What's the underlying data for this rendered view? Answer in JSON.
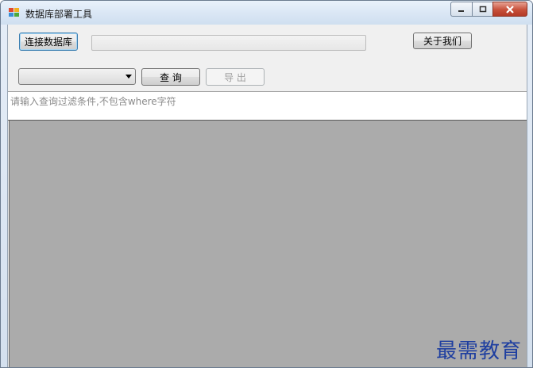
{
  "window": {
    "title": "数据库部署工具",
    "minimize_label": "minimize",
    "maximize_label": "maximize",
    "close_label": "close"
  },
  "toolbar": {
    "connect_label": "连接数据库",
    "about_label": "关于我们",
    "query_label": "查 询",
    "export_label": "导 出",
    "table_select_value": ""
  },
  "filter": {
    "placeholder": "请输入查询过滤条件,不包含where字符"
  },
  "watermark": {
    "text": "最需教育"
  },
  "colors": {
    "grid_background": "#ababab",
    "watermark": "#1f3fa0"
  }
}
